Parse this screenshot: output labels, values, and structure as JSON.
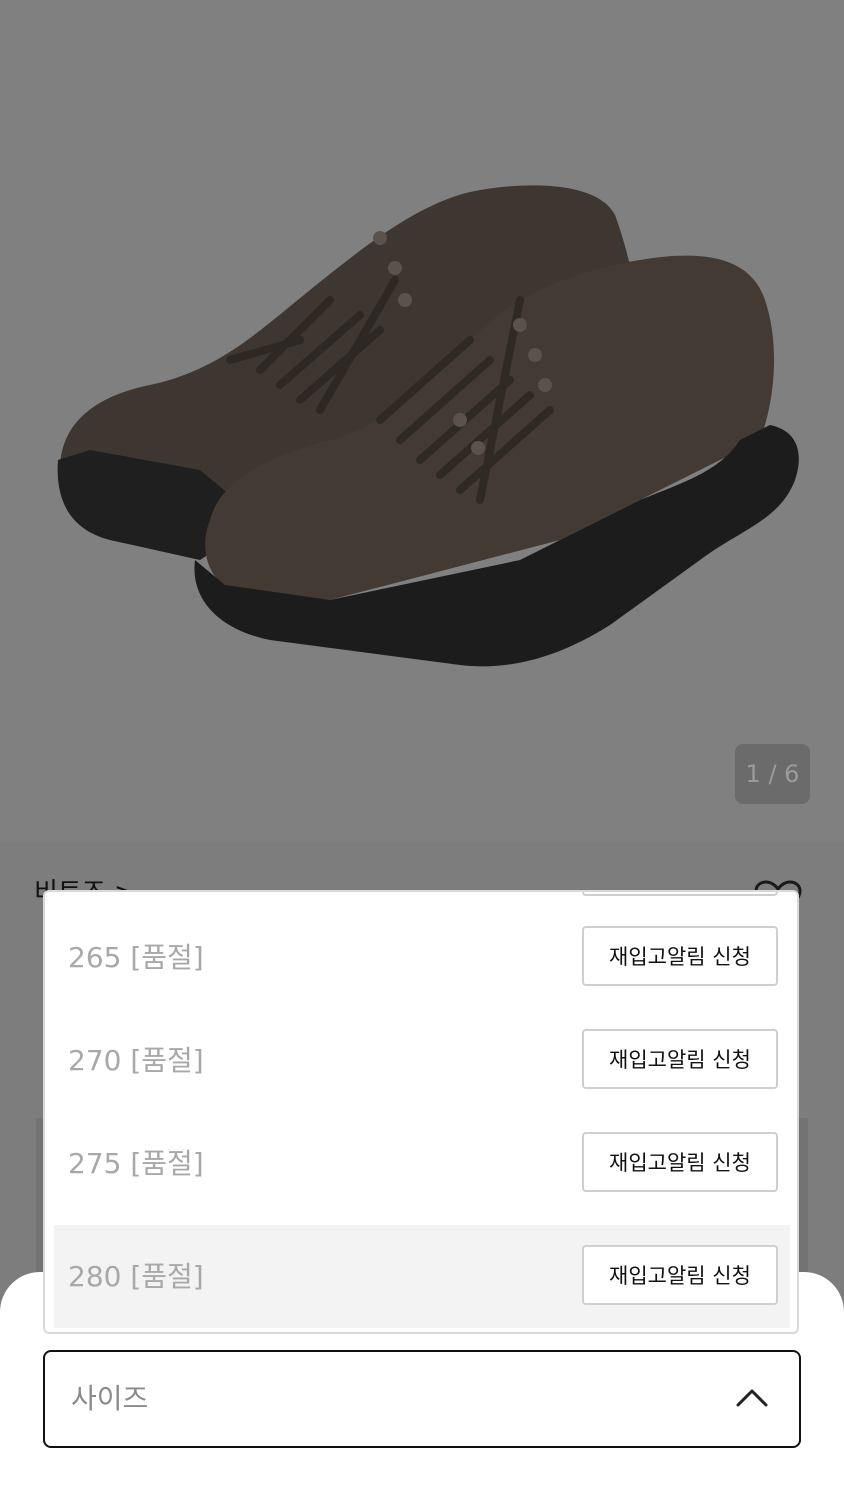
{
  "gallery": {
    "counter": "1 / 6"
  },
  "product_under": {
    "brand": "비토즈 >"
  },
  "size_options": [
    {
      "label": "265 [품절]",
      "action": "재입고알림 신청",
      "selected": false
    },
    {
      "label": "270 [품절]",
      "action": "재입고알림 신청",
      "selected": false
    },
    {
      "label": "275 [품절]",
      "action": "재입고알림 신청",
      "selected": false
    },
    {
      "label": "280 [품절]",
      "action": "재입고알림 신청",
      "selected": true
    }
  ],
  "size_select": {
    "placeholder": "사이즈"
  },
  "colors": {
    "overlay_gray": "#808080",
    "sheet_bg": "#ffffff",
    "border_dark": "#111111",
    "sold_out_text": "#a8a8a8"
  }
}
